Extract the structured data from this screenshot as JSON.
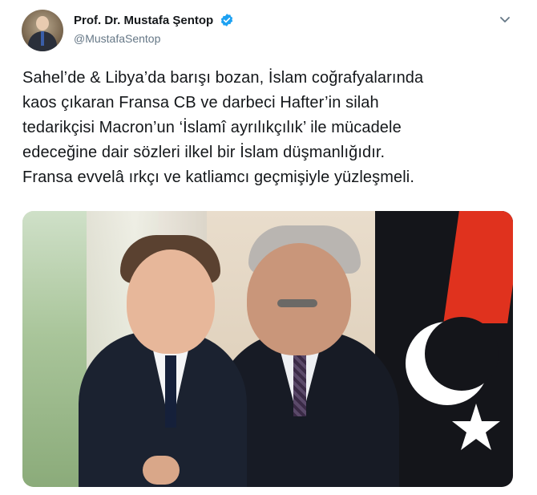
{
  "tweet": {
    "author_name": "Prof. Dr. Mustafa Şentop",
    "author_handle": "@MustafaSentop",
    "text_lines": [
      "Sahel’de & Libya’da barışı bozan, İslam coğrafyalarında",
      "kaos çıkaran Fransa CB ve darbeci Hafter’in silah",
      "tedarikçisi Macron’un ‘İslamî ayrılıkçılık’ ile mücadele",
      "edeceğine dair sözleri ilkel bir İslam düşmanlığıdır.",
      "Fransa evvelâ ırkçı ve katliamcı geçmişiyle yüzleşmeli."
    ]
  },
  "icons": {
    "verified": "verified-badge-icon",
    "menu": "chevron-down-icon"
  },
  "colors": {
    "verified_blue": "#1da1f2",
    "text_primary": "#14171a",
    "text_secondary": "#657786"
  }
}
